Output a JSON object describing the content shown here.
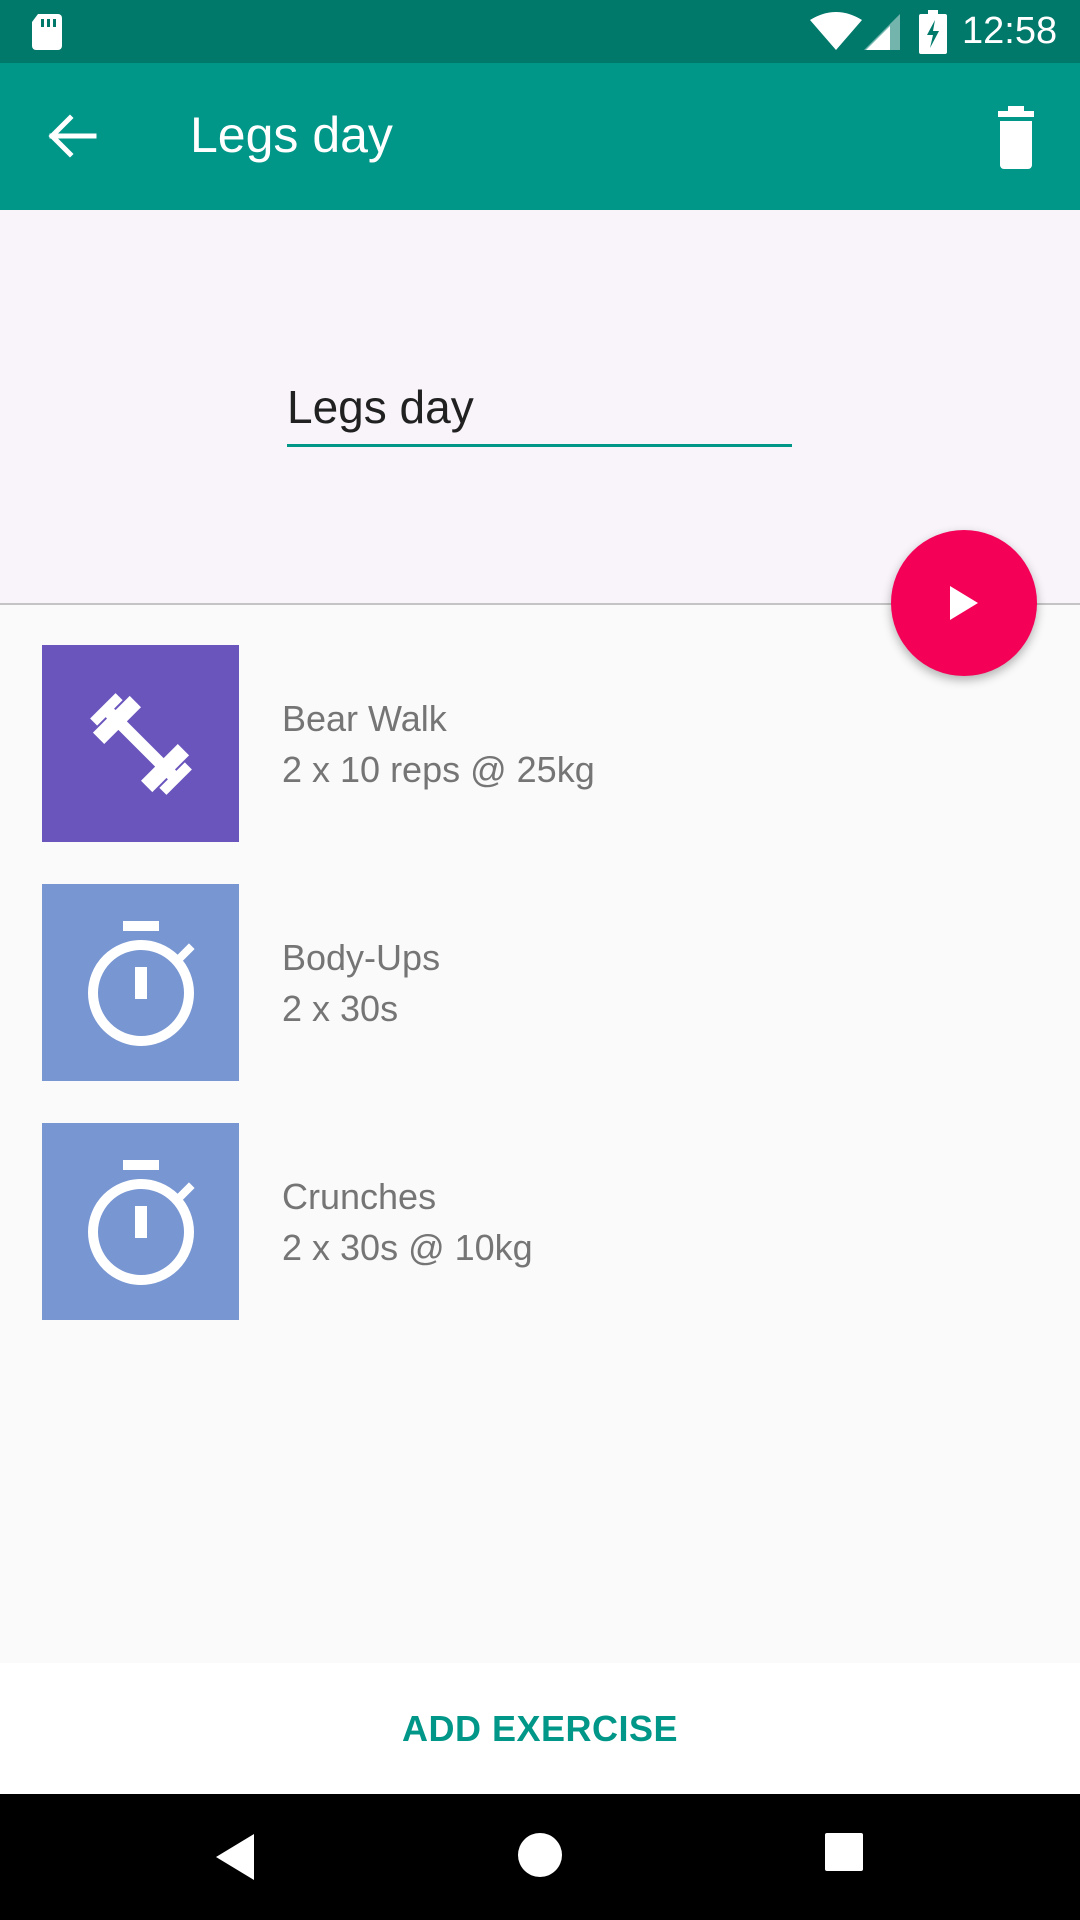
{
  "status_bar": {
    "time": "12:58",
    "icons": [
      "sd-card-icon",
      "wifi-icon",
      "signal-icon",
      "battery-charging-icon"
    ]
  },
  "app_bar": {
    "title": "Legs day",
    "back_icon": "arrow-back-icon",
    "delete_icon": "delete-icon"
  },
  "header": {
    "name_value": "Legs day",
    "fab_icon": "play-icon"
  },
  "exercises": [
    {
      "name": "Bear Walk",
      "detail": "2 x 10 reps @ 25kg",
      "icon": "dumbbell-icon",
      "color": "#6a55bd"
    },
    {
      "name": "Body-Ups",
      "detail": "2 x 30s",
      "icon": "stopwatch-icon",
      "color": "#7796d2"
    },
    {
      "name": "Crunches",
      "detail": "2 x 30s @ 10kg",
      "icon": "stopwatch-icon",
      "color": "#7796d2"
    }
  ],
  "footer": {
    "add_label": "ADD EXERCISE"
  },
  "colors": {
    "primary": "#009688",
    "primary_dark": "#00796b",
    "accent": "#f50057"
  },
  "nav_bar": {
    "icons": [
      "nav-back-icon",
      "nav-home-icon",
      "nav-recents-icon"
    ]
  }
}
